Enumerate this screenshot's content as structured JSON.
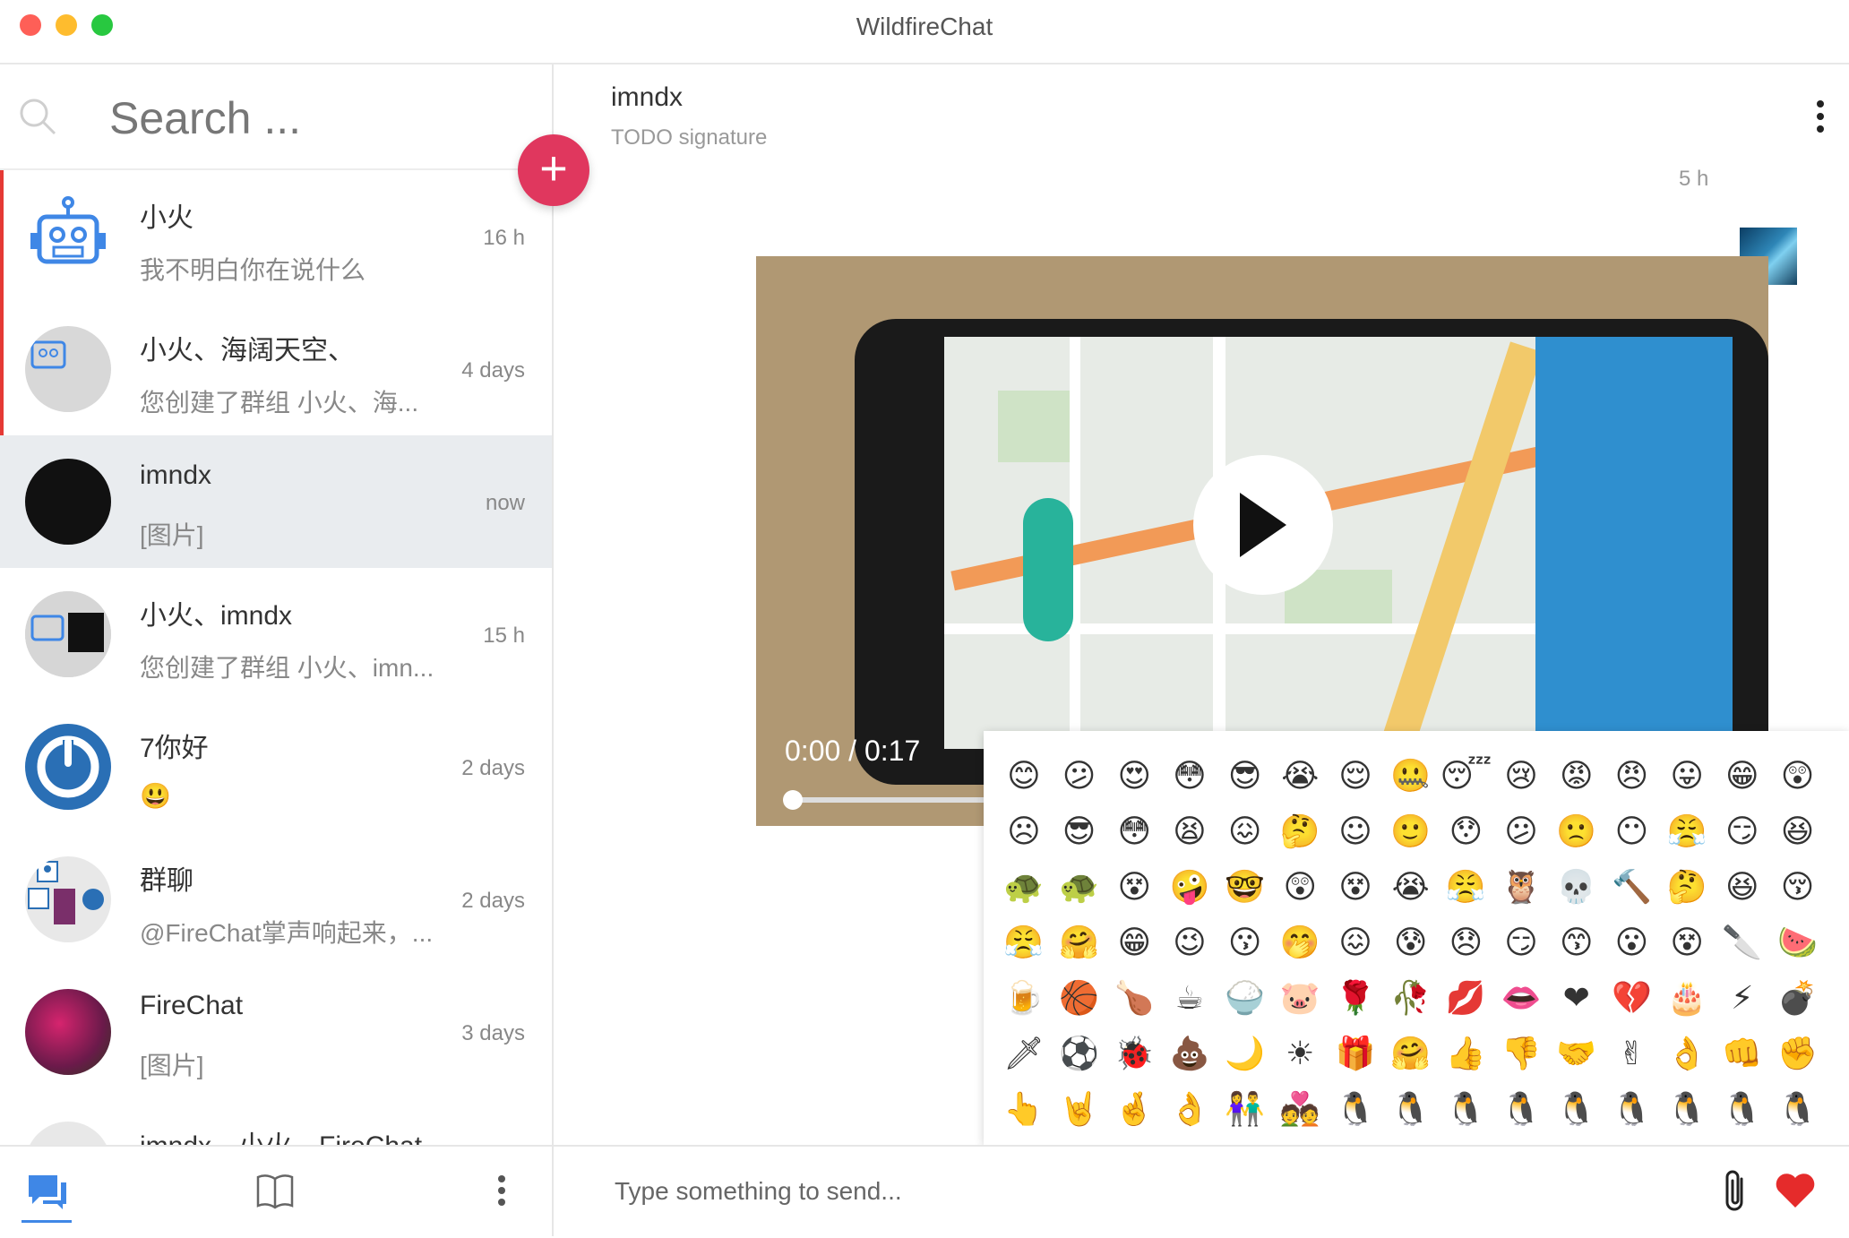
{
  "window": {
    "title": "WildfireChat"
  },
  "search": {
    "placeholder": "Search ..."
  },
  "add_button": {
    "label": "+"
  },
  "conversations": [
    {
      "name": "小火",
      "preview": "我不明白你在说什么",
      "time": "16 h",
      "unread": true
    },
    {
      "name": "小火、海阔天空、",
      "preview": "您创建了群组 小火、海...",
      "time": "4 days",
      "unread": true
    },
    {
      "name": "imndx",
      "preview": "[图片]",
      "time": "now",
      "active": true
    },
    {
      "name": "小火、imndx",
      "preview": "您创建了群组 小火、imn...",
      "time": "15 h"
    },
    {
      "name": "7你好",
      "preview": "😃",
      "time": "2 days"
    },
    {
      "name": "群聊",
      "preview": "@FireChat掌声响起来，...",
      "time": "2 days"
    },
    {
      "name": "FireChat",
      "preview": "[图片]",
      "time": "3 days"
    },
    {
      "name": "imndx、小火、FireChat",
      "preview": "",
      "time": ""
    }
  ],
  "chat": {
    "peer_name": "imndx",
    "peer_signature": "TODO signature",
    "message_time": "5 h",
    "video": {
      "time_display": "0:00 / 0:17",
      "progress": 0.0
    }
  },
  "emoji_panel": {
    "emojis": [
      "😊",
      "😕",
      "😍",
      "😳",
      "😎",
      "😭",
      "😌",
      "🤐",
      "😴",
      "😢",
      "😡",
      "😠",
      "😛",
      "😁",
      "😲",
      "☹",
      "😎",
      "😳",
      "😫",
      "😖",
      "🤔",
      "☺",
      "🙂",
      "😯",
      "😕",
      "🙁",
      "😶",
      "😤",
      "😏",
      "😆",
      "🐢",
      "🐢",
      "😵",
      "🤪",
      "🤓",
      "😲",
      "😵",
      "😭",
      "😤",
      "🦉",
      "💀",
      "🔨",
      "🤔",
      "😆",
      "😚",
      "😤",
      "🤗",
      "😁",
      "😉",
      "😗",
      "🤭",
      "😖",
      "😰",
      "😞",
      "😏",
      "😙",
      "😮",
      "😵",
      "🔪",
      "🍉",
      "🍺",
      "🏀",
      "🍗",
      "☕",
      "🍚",
      "🐷",
      "🌹",
      "🥀",
      "💋",
      "👄",
      "❤",
      "💔",
      "🎂",
      "⚡",
      "💣",
      "🗡",
      "⚽",
      "🐞",
      "💩",
      "🌙",
      "☀",
      "🎁",
      "🤗",
      "👍",
      "👎",
      "🤝",
      "✌",
      "👌",
      "👊",
      "✊",
      "👆",
      "🤘",
      "🤞",
      "👌",
      "👫",
      "💑",
      "🐧",
      "🐧",
      "🐧",
      "🐧",
      "🐧",
      "🐧",
      "🐧",
      "🐧",
      "🐧"
    ]
  },
  "composer": {
    "placeholder": "Type something to send..."
  },
  "colors": {
    "accent": "#e0375e",
    "nav_active": "#3f87e6",
    "unread_bar": "#e53935"
  }
}
